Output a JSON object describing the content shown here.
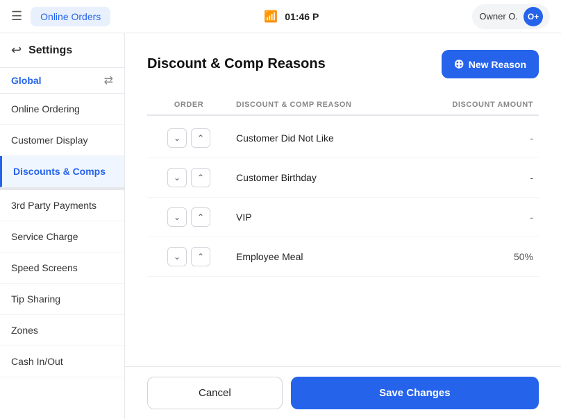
{
  "topbar": {
    "online_orders_label": "Online Orders",
    "time": "01:46 P",
    "owner_label": "Owner O.",
    "owner_initials": "O+"
  },
  "sidebar": {
    "back_label": "Settings",
    "tab_global": "Global",
    "items": [
      {
        "id": "online-ordering",
        "label": "Online Ordering",
        "active": false
      },
      {
        "id": "customer-display",
        "label": "Customer Display",
        "active": false
      },
      {
        "id": "discounts-comps",
        "label": "Discounts & Comps",
        "active": true
      },
      {
        "id": "3rd-party-payments",
        "label": "3rd Party Payments",
        "active": false
      },
      {
        "id": "service-charge",
        "label": "Service Charge",
        "active": false
      },
      {
        "id": "speed-screens",
        "label": "Speed Screens",
        "active": false
      },
      {
        "id": "tip-sharing",
        "label": "Tip Sharing",
        "active": false
      },
      {
        "id": "zones",
        "label": "Zones",
        "active": false
      },
      {
        "id": "cash-in-out",
        "label": "Cash In/Out",
        "active": false
      }
    ]
  },
  "content": {
    "title": "Discount & Comp Reasons",
    "new_reason_btn": "New Reason",
    "columns": {
      "order": "ORDER",
      "reason": "DISCOUNT & COMP REASON",
      "amount": "DISCOUNT AMOUNT"
    },
    "rows": [
      {
        "id": 1,
        "name": "Customer Did Not Like",
        "amount": "-"
      },
      {
        "id": 2,
        "name": "Customer Birthday",
        "amount": "-"
      },
      {
        "id": 3,
        "name": "VIP",
        "amount": "-"
      },
      {
        "id": 4,
        "name": "Employee Meal",
        "amount": "50%"
      }
    ],
    "cancel_btn": "Cancel",
    "save_btn": "Save Changes"
  },
  "icons": {
    "hamburger": "≡",
    "back": "↩",
    "shuffle": "⇄",
    "chevron_down": "˅",
    "chevron_up": "˄",
    "plus_circle": "⊕",
    "wifi": "📶"
  }
}
